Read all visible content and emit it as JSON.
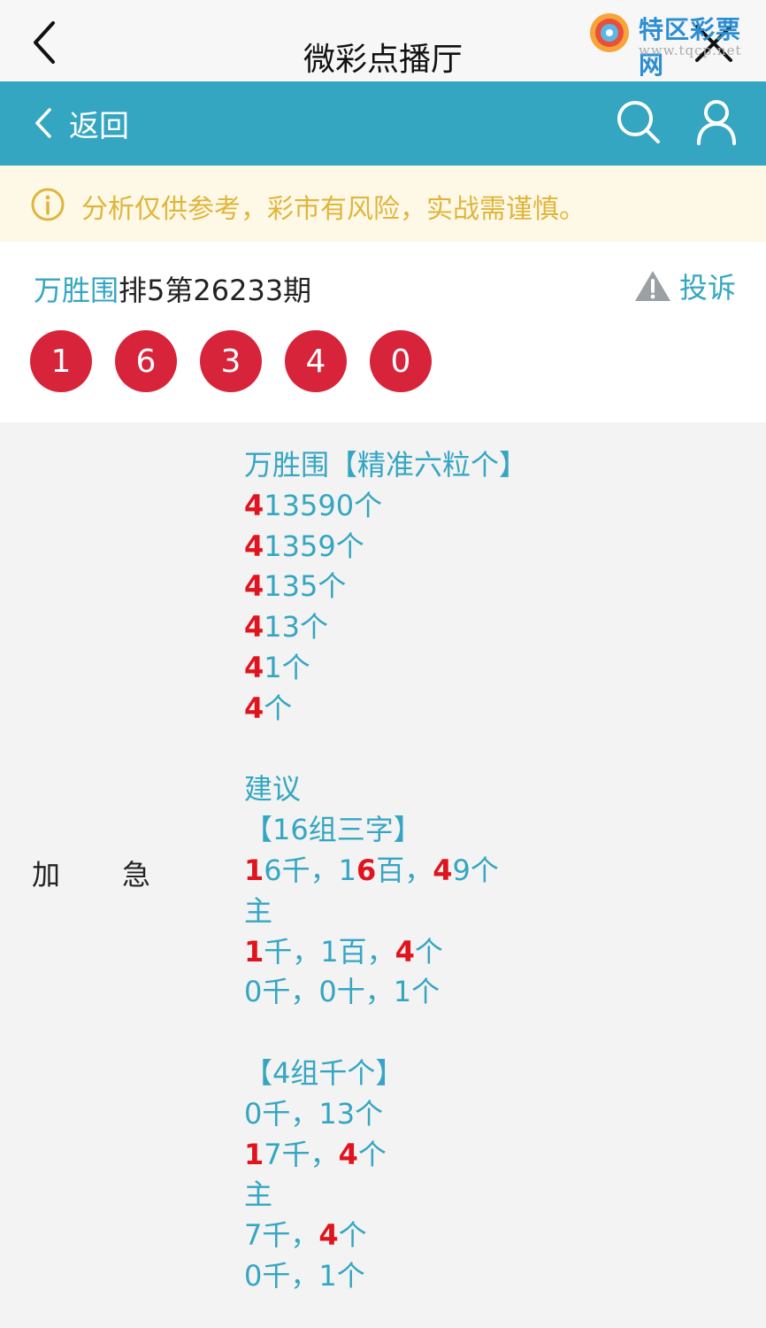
{
  "titlebar": {
    "title": "微彩点播厅"
  },
  "watermark": {
    "text": "特区彩票网",
    "url": "www.tqcp.net"
  },
  "navbar": {
    "back_label": "返回"
  },
  "notice": {
    "text": "分析仅供参考，彩市有风险，实战需谨慎。"
  },
  "header": {
    "author": "万胜围",
    "issue": "排5第26233期",
    "report_label": "投诉",
    "balls": [
      "1",
      "6",
      "3",
      "4",
      "0"
    ]
  },
  "content": {
    "label_a": "加",
    "label_b": "急",
    "lines": [
      [
        {
          "t": "万胜围【精准六粒个】"
        }
      ],
      [
        {
          "t": "4",
          "r": true
        },
        {
          "t": "13590个"
        }
      ],
      [
        {
          "t": "4",
          "r": true
        },
        {
          "t": "1359个"
        }
      ],
      [
        {
          "t": "4",
          "r": true
        },
        {
          "t": "135个"
        }
      ],
      [
        {
          "t": "4",
          "r": true
        },
        {
          "t": "13个"
        }
      ],
      [
        {
          "t": "4",
          "r": true
        },
        {
          "t": "1个"
        }
      ],
      [
        {
          "t": "4",
          "r": true
        },
        {
          "t": "个"
        }
      ],
      [],
      [
        {
          "t": "建议"
        }
      ],
      [
        {
          "t": "【16组三字】"
        }
      ],
      [
        {
          "t": "1",
          "r": true
        },
        {
          "t": "6千，1"
        },
        {
          "t": "6",
          "r": true
        },
        {
          "t": "百，"
        },
        {
          "t": "4",
          "r": true
        },
        {
          "t": "9个"
        }
      ],
      [
        {
          "t": "主"
        }
      ],
      [
        {
          "t": "1",
          "r": true
        },
        {
          "t": "千，1百，"
        },
        {
          "t": "4",
          "r": true
        },
        {
          "t": "个"
        }
      ],
      [
        {
          "t": "0千，0十，1个"
        }
      ],
      [],
      [
        {
          "t": "【4组千个】"
        }
      ],
      [
        {
          "t": "0千，13个"
        }
      ],
      [
        {
          "t": "1",
          "r": true
        },
        {
          "t": "7千，"
        },
        {
          "t": "4",
          "r": true
        },
        {
          "t": "个"
        }
      ],
      [
        {
          "t": "主"
        }
      ],
      [
        {
          "t": "7千，"
        },
        {
          "t": "4",
          "r": true
        },
        {
          "t": "个"
        }
      ],
      [
        {
          "t": "0千，1个"
        }
      ]
    ]
  },
  "colors": {
    "accent": "#35a6c2",
    "ball": "#d7243a",
    "highlight": "#e0141e",
    "notice_text": "#e0b53c",
    "notice_bg": "#fdf9e6"
  },
  "icons": [
    "back-chevron-icon",
    "close-icon",
    "search-icon",
    "user-icon",
    "info-icon",
    "warning-icon",
    "lottery-logo-icon"
  ]
}
